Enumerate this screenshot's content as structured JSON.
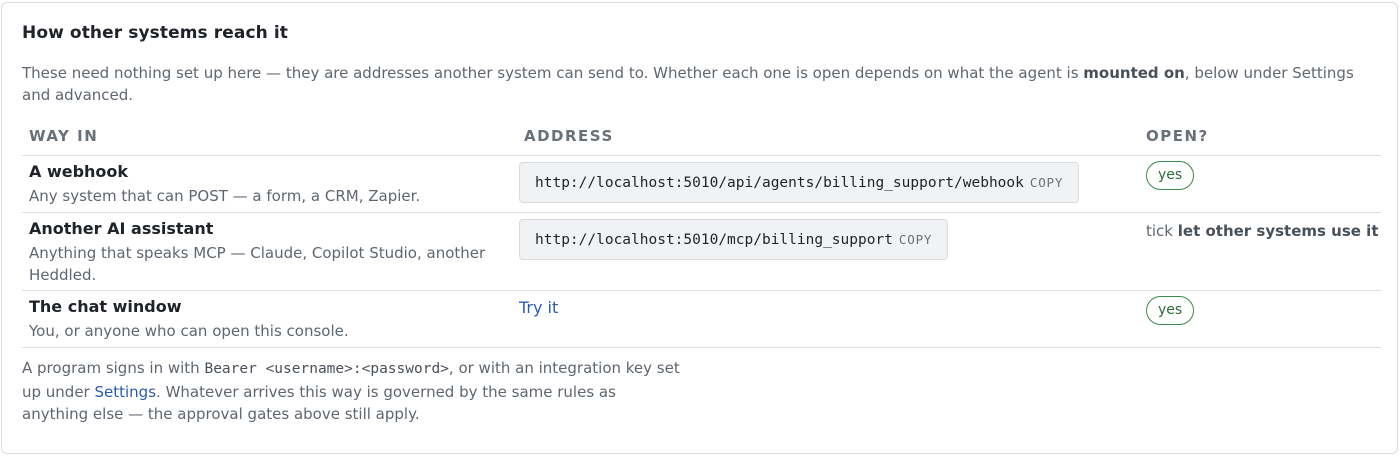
{
  "title": "How other systems reach it",
  "intro": {
    "before": "These need nothing set up here — they are addresses another system can send to. Whether each one is open depends on what the agent is ",
    "bold": "mounted on",
    "after": ", below under Settings and advanced."
  },
  "table": {
    "headers": [
      "WAY IN",
      "ADDRESS",
      "OPEN?"
    ],
    "rows": [
      {
        "name": "A webhook",
        "desc": "Any system that can POST — a form, a CRM, Zapier.",
        "address": "http://localhost:5010/api/agents/billing_support/webhook",
        "copy_label": "COPY",
        "open": "yes"
      },
      {
        "name": "Another AI assistant",
        "desc": "Anything that speaks MCP — Claude, Copilot Studio, another Heddled.",
        "address": "http://localhost:5010/mcp/billing_support",
        "copy_label": "COPY",
        "open_prefix": "tick ",
        "open_bold": "let other systems use it"
      },
      {
        "name": "The chat window",
        "desc": "You, or anyone who can open this console.",
        "link": "Try it",
        "open": "yes"
      }
    ]
  },
  "footer": {
    "t1": "A program signs in with ",
    "code": "Bearer <username>:<password>",
    "t2": ", or with an integration key set up under ",
    "link": "Settings",
    "t3": ". Whatever arrives this way is governed by the same rules as anything else — the approval gates above still apply."
  },
  "colors": {
    "accent_link": "#2a5bb5",
    "badge_green": "#3d8a4f"
  }
}
